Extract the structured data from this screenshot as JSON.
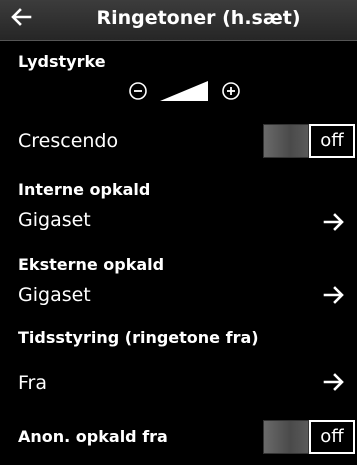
{
  "header": {
    "title": "Ringetoner (h.sæt)"
  },
  "volume": {
    "section_label": "Lydstyrke"
  },
  "crescendo": {
    "label": "Crescendo",
    "toggle_label": "off"
  },
  "internal_calls": {
    "section_label": "Interne opkald",
    "value": "Gigaset"
  },
  "external_calls": {
    "section_label": "Eksterne opkald",
    "value": "Gigaset"
  },
  "time_control": {
    "section_label": "Tidsstyring (ringetone fra)",
    "value": "Fra"
  },
  "anon_calls": {
    "label": "Anon. opkald fra",
    "toggle_label": "off"
  },
  "icons": [
    "back-arrow-icon",
    "minus-circle-icon",
    "volume-wedge-icon",
    "plus-circle-icon",
    "arrow-right-icon"
  ]
}
